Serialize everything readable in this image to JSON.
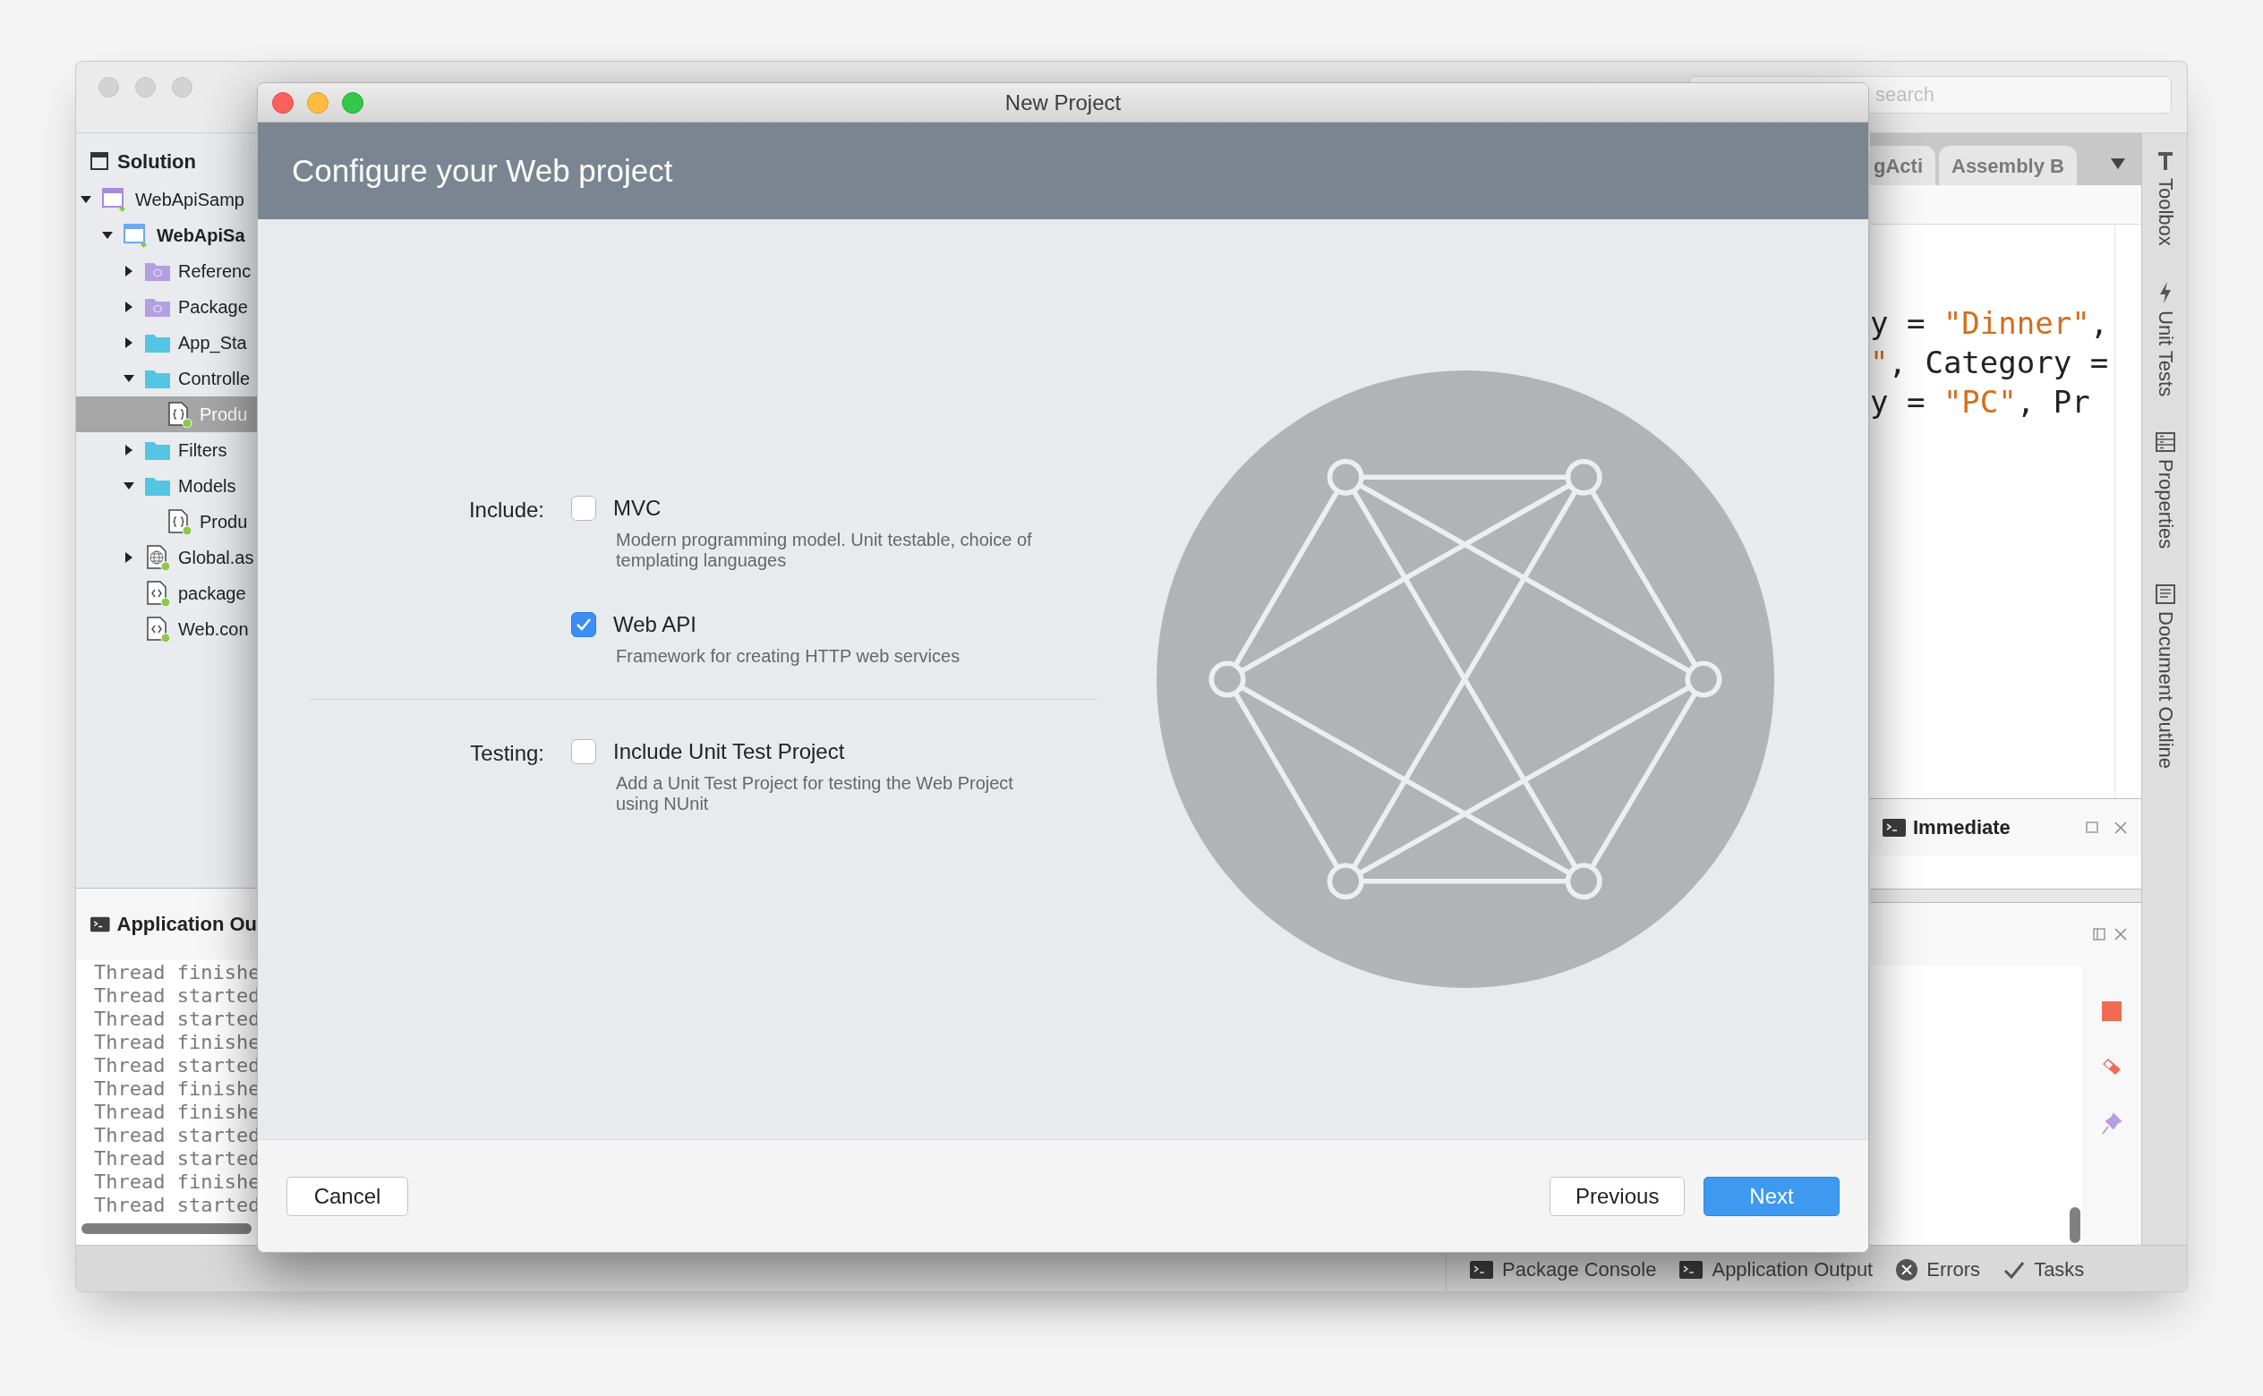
{
  "ide": {
    "search": {
      "placeholder": "search"
    },
    "solution_pad": {
      "title": "Solution",
      "tree": [
        {
          "label": "WebApiSamp",
          "kind": "solution",
          "expanded": true,
          "selected": false,
          "children": [
            {
              "label": "WebApiSa",
              "kind": "project",
              "expanded": true,
              "selected": false,
              "children": [
                {
                  "label": "Referenc",
                  "kind": "references",
                  "expanded": false,
                  "selected": false
                },
                {
                  "label": "Package",
                  "kind": "packages",
                  "expanded": false,
                  "selected": false
                },
                {
                  "label": "App_Sta",
                  "kind": "folder",
                  "expanded": false,
                  "selected": false
                },
                {
                  "label": "Controlle",
                  "kind": "folder",
                  "expanded": true,
                  "selected": false,
                  "children": [
                    {
                      "label": "Produ",
                      "kind": "code",
                      "selected": true
                    }
                  ]
                },
                {
                  "label": "Filters",
                  "kind": "folder",
                  "expanded": false,
                  "selected": false
                },
                {
                  "label": "Models",
                  "kind": "folder",
                  "expanded": true,
                  "selected": false,
                  "children": [
                    {
                      "label": "Produ",
                      "kind": "code",
                      "selected": false
                    }
                  ]
                },
                {
                  "label": "Global.as",
                  "kind": "web",
                  "expanded": false,
                  "selected": false
                },
                {
                  "label": "package",
                  "kind": "config",
                  "selected": false
                },
                {
                  "label": "Web.con",
                  "kind": "config",
                  "selected": false
                }
              ]
            }
          ]
        }
      ]
    },
    "output_pad": {
      "title": "Application Ou",
      "lines": [
        "Thread finishe",
        "Thread started",
        "Thread started",
        "Thread finishe",
        "Thread started",
        "Thread finishe",
        "Thread finishe",
        "Thread started",
        "Thread started",
        "Thread finishe",
        "Thread started"
      ]
    },
    "editor": {
      "tabs": [
        {
          "label": "gActi",
          "selected": false
        },
        {
          "label": "Assembly B",
          "selected": false
        }
      ],
      "code_lines": [
        [
          {
            "kind": "plain",
            "text": "y = "
          },
          {
            "kind": "string",
            "text": "\"Dinner\""
          },
          {
            "kind": "plain",
            "text": ","
          }
        ],
        [
          {
            "kind": "string",
            "text": "\""
          },
          {
            "kind": "plain",
            "text": ", Category ="
          }
        ],
        [
          {
            "kind": "plain",
            "text": "y = "
          },
          {
            "kind": "string",
            "text": "\"PC\""
          },
          {
            "kind": "plain",
            "text": ", Pr"
          }
        ]
      ]
    },
    "immediate_pad": {
      "title": "Immediate"
    },
    "side_toolbar": [
      {
        "label": "Toolbox",
        "kind": "toolbox"
      },
      {
        "label": "Unit Tests",
        "kind": "unit-tests"
      },
      {
        "label": "Properties",
        "kind": "properties"
      },
      {
        "label": "Document Outline",
        "kind": "outline"
      }
    ],
    "status_bar": [
      {
        "label": "Package Console",
        "kind": "console"
      },
      {
        "label": "Application Output",
        "kind": "console"
      },
      {
        "label": "Errors",
        "kind": "errors"
      },
      {
        "label": "Tasks",
        "kind": "tasks"
      }
    ]
  },
  "dialog": {
    "title": "New Project",
    "heading": "Configure your Web project",
    "sections": [
      {
        "label": "Include:",
        "options": [
          {
            "label": "MVC",
            "description": "Modern programming model. Unit testable, choice of templating languages",
            "checked": false
          },
          {
            "label": "Web API",
            "description": "Framework for creating HTTP web services",
            "checked": true
          }
        ]
      },
      {
        "label": "Testing:",
        "options": [
          {
            "label": "Include Unit Test Project",
            "description": "Add a Unit Test Project for testing the Web Project using NUnit",
            "checked": false
          }
        ]
      }
    ],
    "buttons": [
      {
        "label": "Cancel",
        "kind": "secondary"
      },
      {
        "label": "Previous",
        "kind": "secondary"
      },
      {
        "label": "Next",
        "kind": "primary"
      }
    ]
  }
}
